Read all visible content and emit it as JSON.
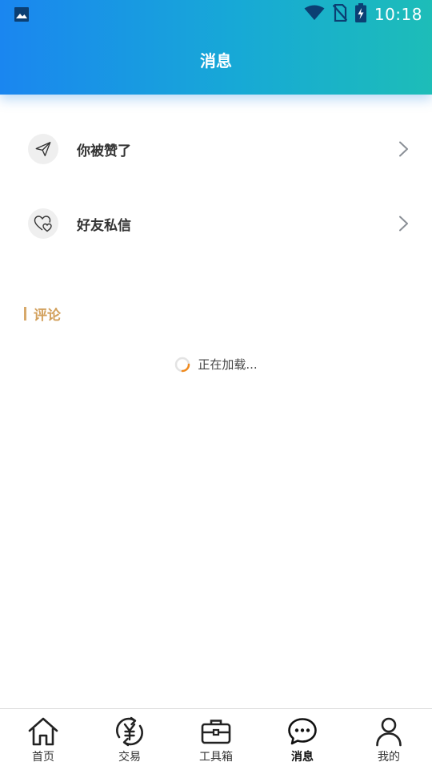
{
  "status_bar": {
    "time": "10:18",
    "icons": [
      "image-icon",
      "wifi-icon",
      "no-sim-icon",
      "battery-charging-icon"
    ]
  },
  "header": {
    "title": "消息"
  },
  "list": {
    "items": [
      {
        "icon": "paper-plane-icon",
        "label": "你被赞了"
      },
      {
        "icon": "double-heart-icon",
        "label": "好友私信"
      }
    ]
  },
  "comments": {
    "title": "评论",
    "loading_text": "正在加载..."
  },
  "bottom_nav": {
    "active": "消息",
    "items": [
      {
        "icon": "home-icon",
        "label": "首页"
      },
      {
        "icon": "yen-exchange-icon",
        "label": "交易"
      },
      {
        "icon": "toolbox-icon",
        "label": "工具箱"
      },
      {
        "icon": "chat-bubble-icon",
        "label": "消息"
      },
      {
        "icon": "person-icon",
        "label": "我的"
      }
    ]
  },
  "colors": {
    "header_gradient_start": "#1a86f0",
    "header_gradient_end": "#1dbdb8",
    "section_accent": "#d2a05c",
    "spinner_accent": "#f08a1e"
  }
}
